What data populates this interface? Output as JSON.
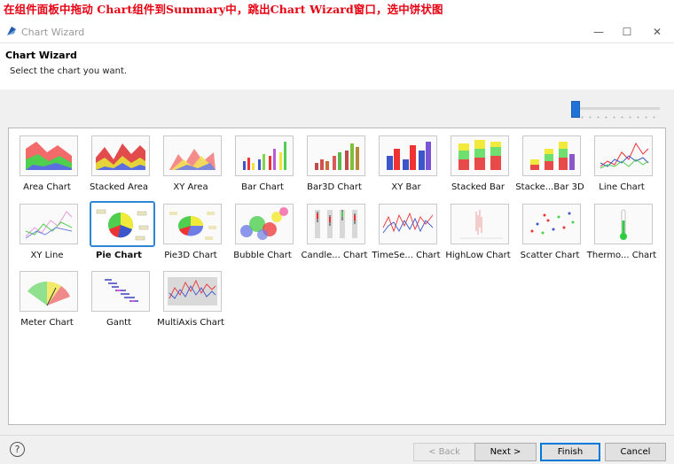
{
  "annotation": "在组件面板中拖动 Chart组件到Summary中，跳出Chart Wizard窗口，选中饼状图",
  "window": {
    "title": "Chart Wizard",
    "minimize_glyph": "—",
    "maximize_glyph": "☐",
    "close_glyph": "✕"
  },
  "header": {
    "title": "Chart Wizard",
    "subtitle": "Select the chart you want."
  },
  "slider": {
    "value": 0.0
  },
  "gallery": {
    "selected": "Pie Chart",
    "items": [
      {
        "label": "Area Chart",
        "icon": "area-chart-icon"
      },
      {
        "label": "Stacked Area",
        "icon": "stacked-area-icon"
      },
      {
        "label": "XY Area",
        "icon": "xy-area-icon"
      },
      {
        "label": "Bar Chart",
        "icon": "bar-chart-icon"
      },
      {
        "label": "Bar3D Chart",
        "icon": "bar3d-chart-icon"
      },
      {
        "label": "XY Bar",
        "icon": "xy-bar-icon"
      },
      {
        "label": "Stacked Bar",
        "icon": "stacked-bar-icon"
      },
      {
        "label": "Stacke...Bar 3D",
        "icon": "stacked-bar3d-icon"
      },
      {
        "label": "Line Chart",
        "icon": "line-chart-icon"
      },
      {
        "label": "XY Line",
        "icon": "xy-line-icon"
      },
      {
        "label": "Pie Chart",
        "icon": "pie-chart-icon"
      },
      {
        "label": "Pie3D Chart",
        "icon": "pie3d-chart-icon"
      },
      {
        "label": "Bubble Chart",
        "icon": "bubble-chart-icon"
      },
      {
        "label": "Candle... Chart",
        "icon": "candlestick-chart-icon"
      },
      {
        "label": "TimeSe... Chart",
        "icon": "timeseries-chart-icon"
      },
      {
        "label": "HighLow Chart",
        "icon": "highlow-chart-icon"
      },
      {
        "label": "Scatter Chart",
        "icon": "scatter-chart-icon"
      },
      {
        "label": "Thermo... Chart",
        "icon": "thermometer-chart-icon"
      },
      {
        "label": "Meter Chart",
        "icon": "meter-chart-icon"
      },
      {
        "label": "Gantt",
        "icon": "gantt-chart-icon"
      },
      {
        "label": "MultiAxis Chart",
        "icon": "multiaxis-chart-icon"
      }
    ]
  },
  "footer": {
    "help": "?",
    "back": "< Back",
    "next": "Next >",
    "finish": "Finish",
    "cancel": "Cancel"
  },
  "colors": {
    "accent": "#2f86d6",
    "annotation": "#e60012"
  }
}
